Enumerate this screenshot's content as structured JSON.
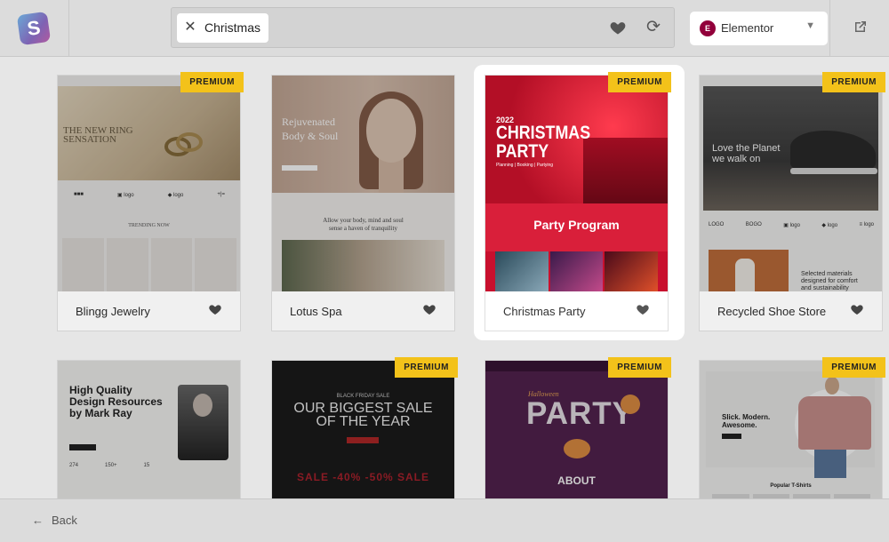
{
  "search": {
    "query": "Christmas",
    "clear_icon": "close-icon"
  },
  "toolbar": {
    "favorites_icon": "heart-icon",
    "sync_icon": "refresh-icon",
    "builder_label": "Elementor",
    "builder_icon": "elementor-icon",
    "external_icon": "external-link-icon"
  },
  "premium_label": "PREMIUM",
  "cards": [
    {
      "name": "Blingg Jewelry",
      "premium": true,
      "art": {
        "headline": "THE NEW RING SENSATION",
        "section": "TRENDING NOW",
        "logos": [
          "■■■",
          "▣ logo",
          "◆ logo",
          "+|= "
        ]
      }
    },
    {
      "name": "Lotus Spa",
      "premium": false,
      "art": {
        "headline_1": "Rejuvenated",
        "headline_2": "Body & Soul",
        "tagline_1": "Allow your body, mind and soul",
        "tagline_2": "sense a haven of tranquility"
      }
    },
    {
      "name": "Christmas Party",
      "premium": true,
      "highlighted": true,
      "art": {
        "year": "2022",
        "headline_1": "CHRISTMAS",
        "headline_2": "PARTY",
        "menu": "Planning   |   Booking   |   Partying",
        "section": "Party Program"
      }
    },
    {
      "name": "Recycled Shoe Store",
      "premium": true,
      "art": {
        "headline_1": "Love the Planet",
        "headline_2": "we walk on",
        "logos": [
          "LOGO",
          "BOGO",
          "▣ logo",
          "◆ logo",
          "≡ logo"
        ],
        "copy_1": "Selected materials",
        "copy_2": "designed for comfort",
        "copy_3": "and sustainability"
      }
    },
    {
      "name": "",
      "premium": false,
      "art": {
        "headline_1": "High Quality",
        "headline_2": "Design Resources",
        "headline_3": "by Mark Ray",
        "stats": [
          "274",
          "150+",
          "15"
        ]
      }
    },
    {
      "name": "",
      "premium": true,
      "art": {
        "kicker": "BLACK FRIDAY SALE",
        "headline_1": "OUR BIGGEST SALE",
        "headline_2": "OF THE YEAR",
        "neon": "SALE -40% -50% SALE"
      }
    },
    {
      "name": "",
      "premium": true,
      "art": {
        "kicker": "Halloween",
        "headline": "PARTY",
        "section": "ABOUT"
      }
    },
    {
      "name": "",
      "premium": true,
      "art": {
        "headline_1": "Slick. Modern.",
        "headline_2": "Awesome.",
        "section": "Popular T-Shirts"
      }
    }
  ],
  "footer": {
    "back_label": "Back",
    "back_icon": "arrow-left-icon"
  },
  "colors": {
    "premium": "#f3c21a",
    "elementor": "#92003b",
    "highlight_bg": "#ffffff"
  }
}
